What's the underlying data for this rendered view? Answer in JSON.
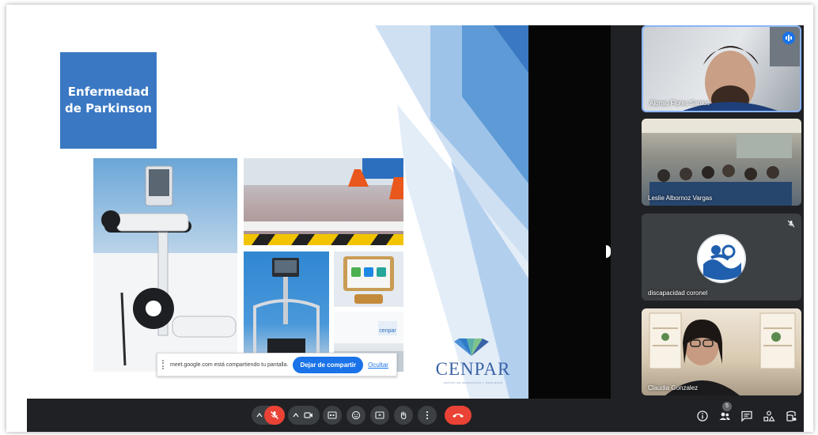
{
  "slide": {
    "title": "Enfermedad\nde Parkinson",
    "logo_text": "CENPAR",
    "logo_tagline": "CENTRO DE NEUROLOGÍA Y PARKINSON"
  },
  "share_bar": {
    "message": "meet.google.com está compartiendo tu pantalla.",
    "stop_label": "Dejar de compartir",
    "hide_label": "Ocultar"
  },
  "participants": [
    {
      "name": "Alonso Flores Santos",
      "speaking": true
    },
    {
      "name": "Leslie Albornoz Vargas",
      "speaking": false
    },
    {
      "name": "discapacidad coronel",
      "muted": true
    },
    {
      "name": "Claudia Gonzalez",
      "speaking": false
    }
  ],
  "controls": {
    "people_count": "5",
    "colors": {
      "end_call": "#ea4335",
      "mic_off": "#ea4335",
      "bar": "#202124",
      "pill": "#3c4043"
    },
    "icons": [
      "chevron-up-icon",
      "mic-off-icon",
      "camera-icon",
      "captions-icon",
      "emoji-icon",
      "present-icon",
      "hand-icon",
      "more-icon",
      "end-call-icon",
      "info-icon",
      "people-icon",
      "chat-icon",
      "activities-icon",
      "host-controls-icon"
    ]
  }
}
